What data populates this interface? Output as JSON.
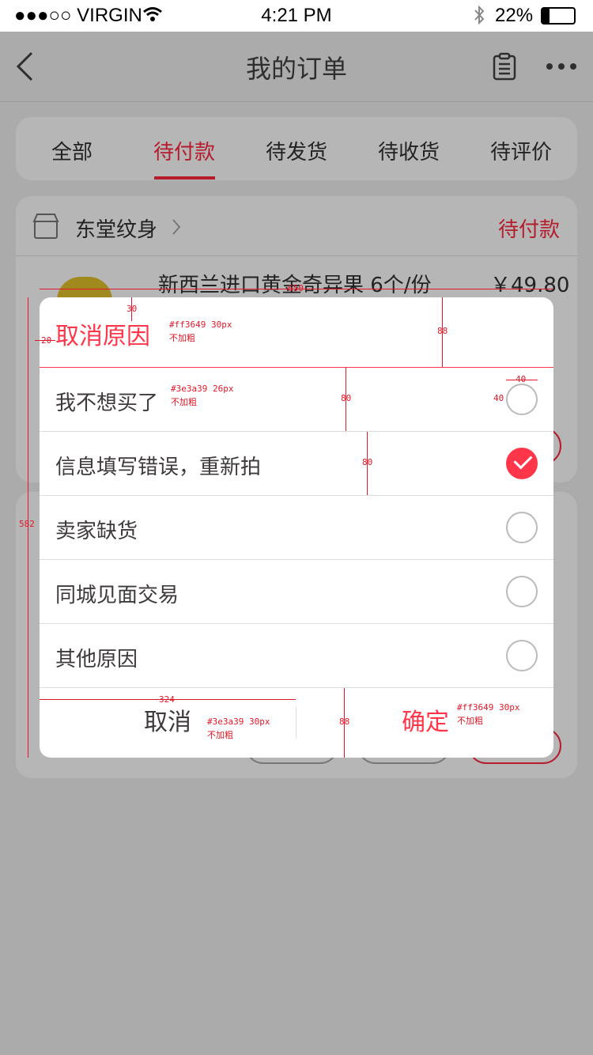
{
  "status_bar": {
    "carrier": "●●●○○ VIRGIN",
    "time": "4:21 PM",
    "battery": "22%"
  },
  "nav": {
    "title": "我的订单"
  },
  "tabs": [
    {
      "label": "全部"
    },
    {
      "label": "待付款",
      "active": true
    },
    {
      "label": "待发货"
    },
    {
      "label": "待收货"
    },
    {
      "label": "待评价"
    }
  ],
  "order": {
    "shop": "东堂纹身",
    "status": "待付款",
    "product": "新西兰进口黄金奇异果 6个/份",
    "price": "￥49.80"
  },
  "modal": {
    "title": "取消原因",
    "reasons": [
      {
        "label": "我不想买了",
        "selected": false
      },
      {
        "label": "信息填写错误，重新拍",
        "selected": true
      },
      {
        "label": "卖家缺货",
        "selected": false
      },
      {
        "label": "同城见面交易",
        "selected": false
      },
      {
        "label": "其他原因",
        "selected": false
      }
    ],
    "cancel_label": "取消",
    "confirm_label": "确定"
  },
  "annotations": {
    "width": "650",
    "height": "582",
    "padding": "20",
    "title_offset": "30",
    "title_height": "88",
    "row_height_1": "80",
    "row_height_2": "80",
    "radio_w": "40",
    "radio_h": "40",
    "btn_width": "324",
    "btn_height": "88",
    "title_color": "#ff3649  30px",
    "title_weight": "不加粗",
    "item_color": "#3e3a39  26px",
    "item_weight": "不加粗",
    "cancel_color": "#3e3a39  30px",
    "cancel_weight": "不加粗",
    "confirm_color": "#ff3649  30px",
    "confirm_weight": "不加粗"
  },
  "colors": {
    "accent": "#ff3649",
    "text": "#3e3a39",
    "overlay": "#ababab"
  }
}
